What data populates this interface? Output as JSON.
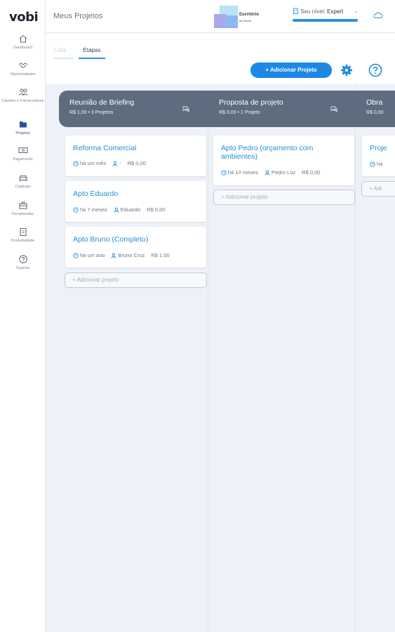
{
  "sidebar": {
    "logo": "vobi",
    "items": [
      {
        "label": "Dashboard",
        "icon": "home-icon"
      },
      {
        "label": "Oportunidades",
        "icon": "handshake-icon"
      },
      {
        "label": "Clientes e Fornecedores",
        "icon": "users-icon"
      },
      {
        "label": "Projetos",
        "icon": "folder-icon",
        "active": true
      },
      {
        "label": "Pagamento",
        "icon": "money-icon"
      },
      {
        "label": "Catálogo",
        "icon": "sofa-icon"
      },
      {
        "label": "Ferramentas",
        "icon": "toolbox-icon"
      },
      {
        "label": "Produtividade",
        "icon": "clipboard-icon"
      },
      {
        "label": "Suporte",
        "icon": "help-icon"
      }
    ]
  },
  "header": {
    "title": "Meus Projetos",
    "brand_name": "Escritório",
    "brand_sub": "do Futuro",
    "level_prefix": "Seu nível:",
    "level_value": "Expert",
    "level_progress": 1.0
  },
  "tabs": {
    "lista": "Lista",
    "etapas": "Etapas",
    "active": "etapas"
  },
  "toolbar": {
    "add_project": "+ Adicionar Projeto"
  },
  "columns": [
    {
      "name": "Reunião de Briefing",
      "summary": "R$ 1,00 • 3 Projetos",
      "cards": [
        {
          "title": "Reforma Comercial",
          "time": "há um mês",
          "person": "-",
          "value": "R$ 0,00"
        },
        {
          "title": "Apto Eduardo",
          "time": "há 7 meses",
          "person": "Eduardo",
          "value": "R$ 0,00"
        },
        {
          "title": "Apto Bruno (Completo)",
          "time": "há um ano",
          "person": "Bruno Cruz",
          "value": "R$ 1,00"
        }
      ],
      "add_label": "+ Adicionar projeto"
    },
    {
      "name": "Proposta de projeto",
      "summary": "R$ 0,00 • 1 Projeto",
      "cards": [
        {
          "title": "Apto Pedro (orçamento com ambientes)",
          "time": "há 10 meses",
          "person": "Pedro Luz",
          "value": "R$ 0,00"
        }
      ],
      "add_label": "+ Adicionar projeto"
    },
    {
      "name": "Obra",
      "summary": "R$ 0,00",
      "cards": [
        {
          "title": "Proje",
          "time": "há"
        }
      ],
      "add_label": "+ Adi"
    }
  ],
  "colors": {
    "accent": "#1e88e5",
    "column_header": "#5d6c7f",
    "card_title": "#1f8fd6",
    "board_bg": "#eef2f8"
  }
}
